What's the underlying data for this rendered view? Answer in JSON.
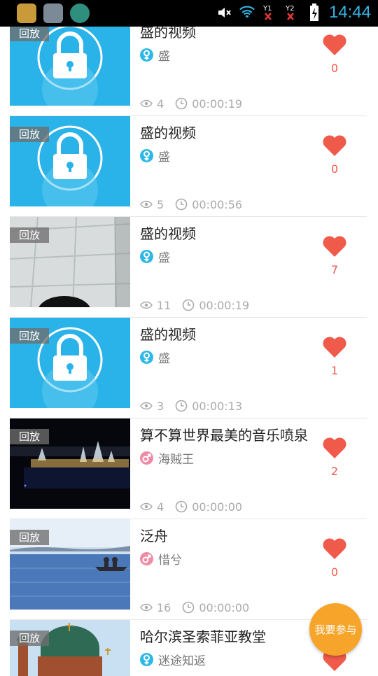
{
  "status_bar": {
    "time": "14:44"
  },
  "badge_label": "回放",
  "videos": [
    {
      "title": "盛的视频",
      "user": "盛",
      "gender": "female",
      "views": "4",
      "duration": "00:00:19",
      "likes": "0",
      "thumb": "locked"
    },
    {
      "title": "盛的视频",
      "user": "盛",
      "gender": "female",
      "views": "5",
      "duration": "00:00:56",
      "likes": "0",
      "thumb": "locked"
    },
    {
      "title": "盛的视频",
      "user": "盛",
      "gender": "female",
      "views": "11",
      "duration": "00:00:19",
      "likes": "7",
      "thumb": "ceiling-photo"
    },
    {
      "title": "盛的视频",
      "user": "盛",
      "gender": "female",
      "views": "3",
      "duration": "00:00:13",
      "likes": "1",
      "thumb": "locked"
    },
    {
      "title": "算不算世界最美的音乐喷泉",
      "user": "海贼王",
      "gender": "male",
      "views": "4",
      "duration": "00:00:00",
      "likes": "2",
      "thumb": "fountain-night"
    },
    {
      "title": "泛舟",
      "user": "惜兮",
      "gender": "male",
      "views": "16",
      "duration": "00:00:00",
      "likes": "0",
      "thumb": "lake-boat"
    },
    {
      "title": "哈尔滨圣索菲亚教堂",
      "user": "迷途知返",
      "gender": "female",
      "views": "",
      "duration": "",
      "likes": "",
      "thumb": "cathedral"
    }
  ],
  "fab_label": "我要参与",
  "colors": {
    "accent": "#33b5e5",
    "heart": "#f05a4a",
    "fab": "#f7a52a",
    "female": "#2eb8e6",
    "male": "#f08aa6"
  }
}
